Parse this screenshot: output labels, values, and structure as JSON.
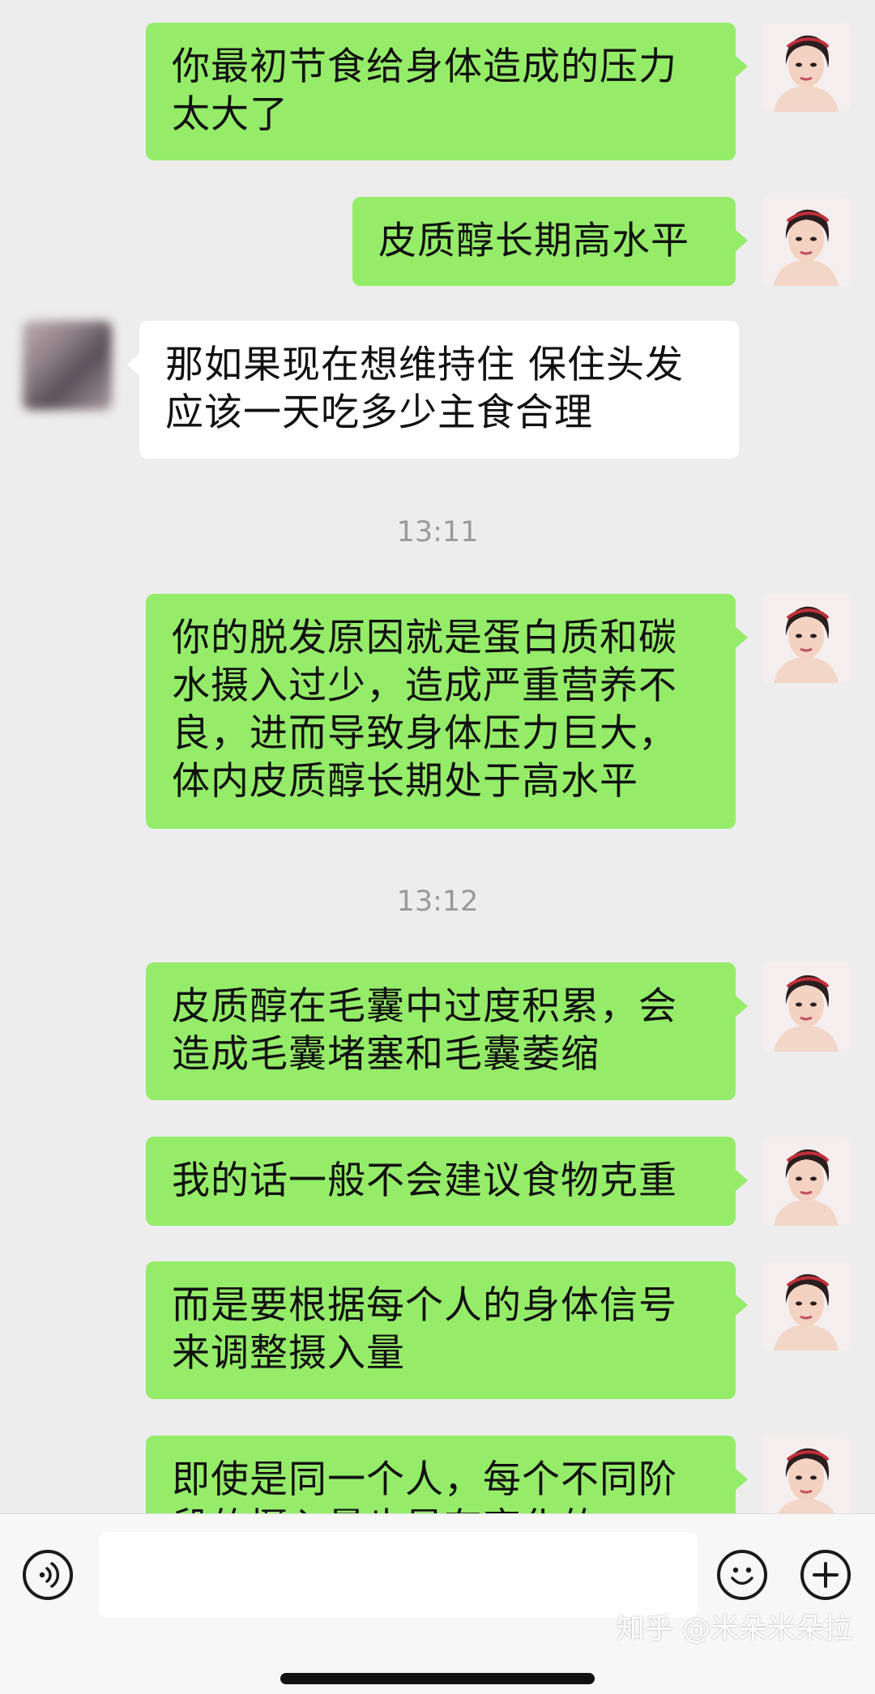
{
  "messages": [
    {
      "text": "你最初节食给身体造成的压力\n太大了",
      "side": "out"
    },
    {
      "text": "皮质醇长期高水平",
      "side": "out"
    },
    {
      "text": "那如果现在想维持住 保住头发\n应该一天吃多少主食合理",
      "side": "in"
    },
    {
      "time": "13:11"
    },
    {
      "text": "你的脱发原因就是蛋白质和碳\n水摄入过少，造成严重营养不\n良，进而导致身体压力巨大，\n体内皮质醇长期处于高水平",
      "side": "out"
    },
    {
      "time": "13:12"
    },
    {
      "text": "皮质醇在毛囊中过度积累，会\n造成毛囊堵塞和毛囊萎缩",
      "side": "out"
    },
    {
      "text": "我的话一般不会建议食物克重",
      "side": "out"
    },
    {
      "text": "而是要根据每个人的身体信号\n来调整摄入量",
      "side": "out"
    },
    {
      "text": "即使是同一个人，每个不同阶\n段的摄入量也是有变化的",
      "side": "out"
    }
  ],
  "input": {
    "value": "",
    "voice_icon": "voice-icon",
    "emoji_icon": "emoji-icon",
    "plus_icon": "plus-icon"
  },
  "watermark": "知乎 @米朵米朵拉",
  "colors": {
    "outgoing_bubble": "#95ec69",
    "incoming_bubble": "#ffffff",
    "background": "#ededed",
    "timestamp": "#9a9a9a"
  }
}
